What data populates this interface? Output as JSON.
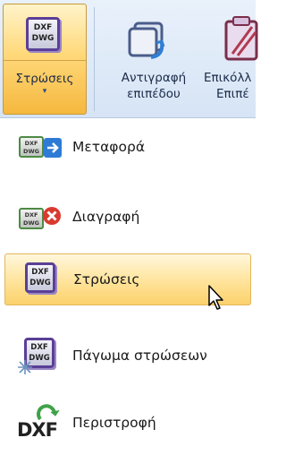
{
  "ribbon": {
    "layers_button": {
      "label": "Στρώσεις",
      "icon_text": [
        "DXF",
        "DWG"
      ],
      "arrow": "▾"
    },
    "copy_button": {
      "label_line1": "Αντιγραφή",
      "label_line2": "επιπέδου"
    },
    "paste_button": {
      "label_line1": "Επικόλλ",
      "label_line2": "Επιπέ"
    }
  },
  "menu": {
    "items": [
      {
        "label": "Μεταφορά",
        "icon": "dxf-transfer-icon",
        "icon_text": [
          "DXF",
          "DWG"
        ]
      },
      {
        "label": "Διαγραφή",
        "icon": "dxf-delete-icon",
        "icon_text": [
          "DXF",
          "DWG"
        ]
      },
      {
        "label": "Στρώσεις",
        "icon": "dxf-layers-icon",
        "icon_text": [
          "DXF",
          "DWG"
        ]
      },
      {
        "label": "Πάγωμα στρώσεων",
        "icon": "dxf-freeze-icon",
        "icon_text": [
          "DXF",
          "DWG"
        ]
      },
      {
        "label": "Περιστροφή",
        "icon": "dxf-rotate-icon",
        "icon_text": [
          "DXF"
        ]
      }
    ]
  },
  "colors": {
    "accent_purple": "#5b3f96",
    "hover_gold": "#ffe39a",
    "ribbon_blue": "#d6e4f5"
  }
}
